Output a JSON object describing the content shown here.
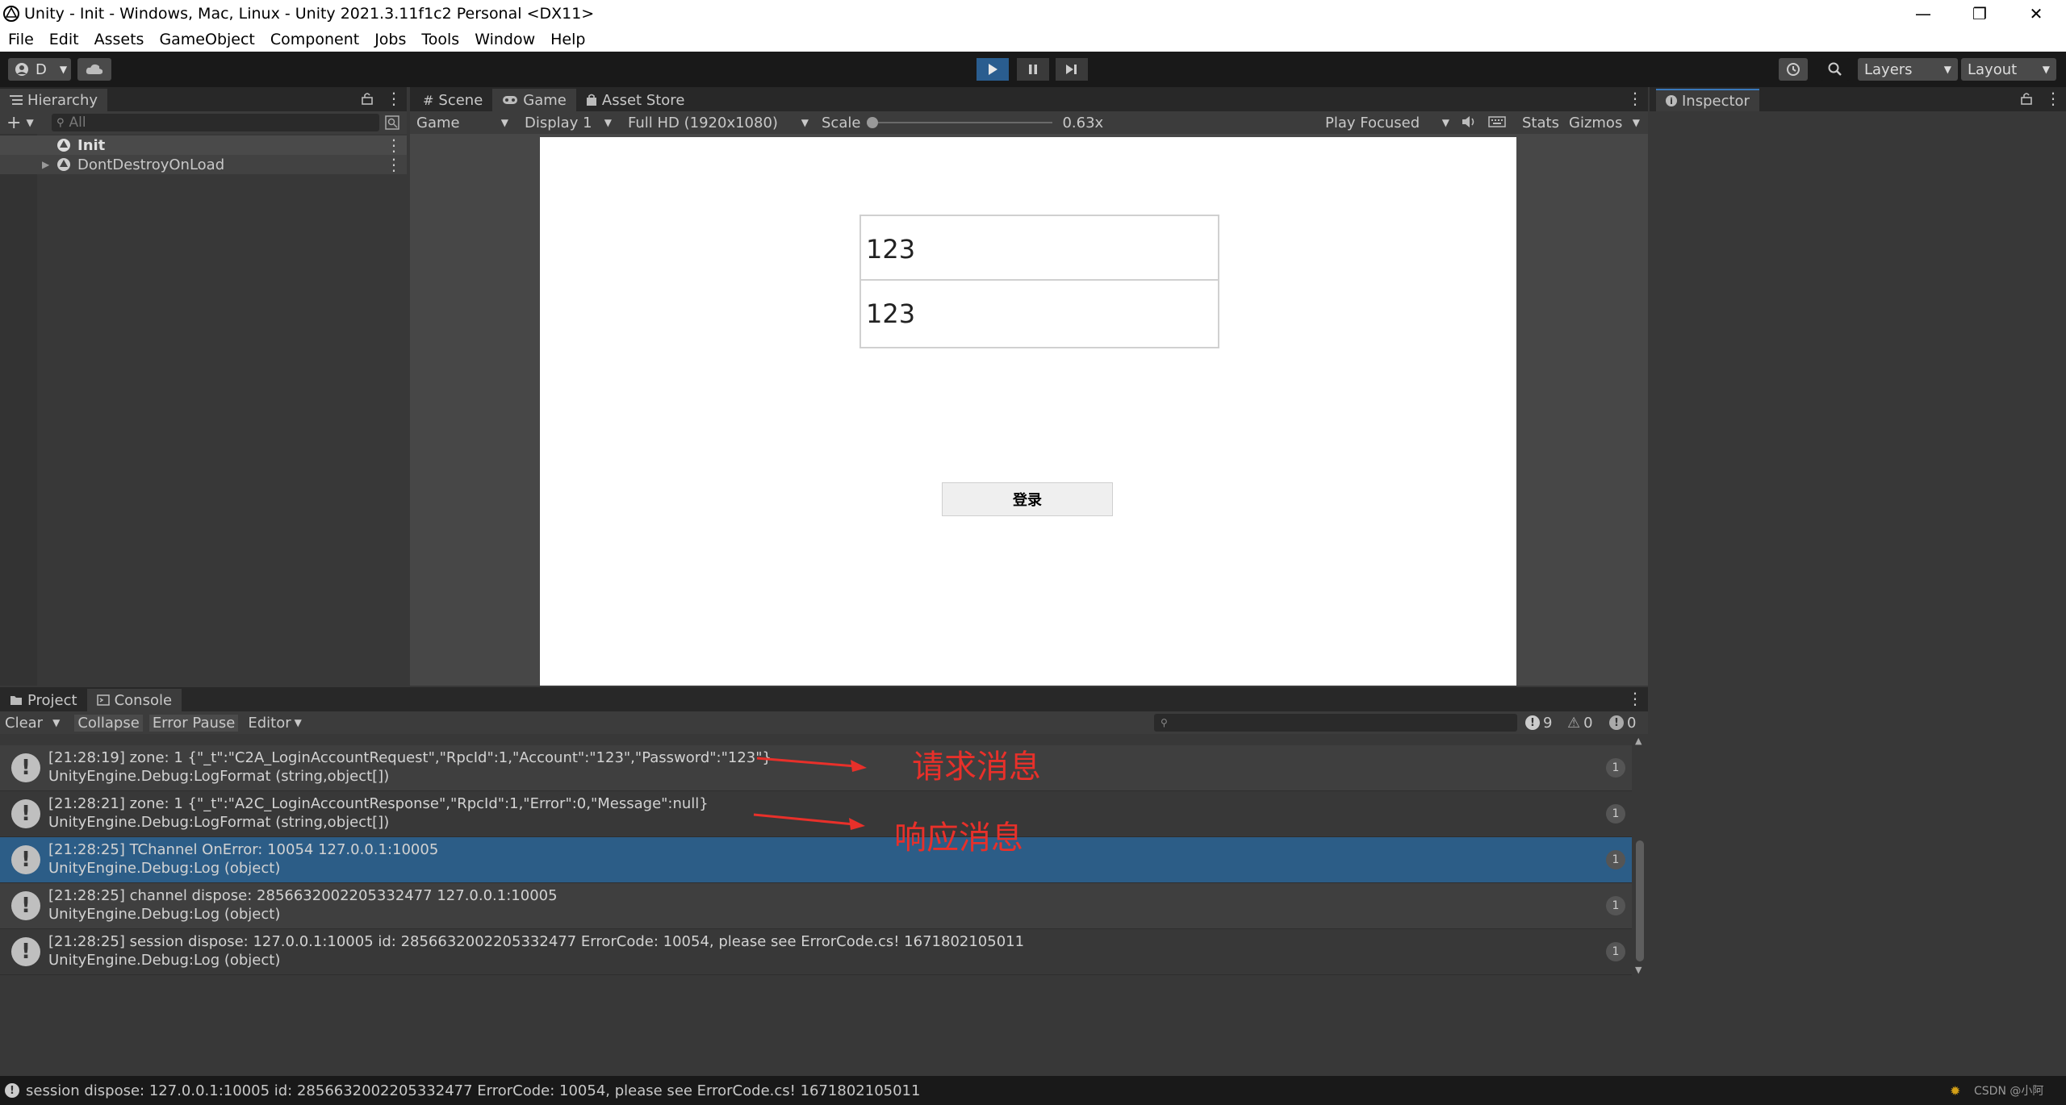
{
  "window": {
    "title": "Unity - Init - Windows, Mac, Linux - Unity 2021.3.11f1c2 Personal <DX11>",
    "minimize": "—",
    "restore": "❐",
    "close": "✕"
  },
  "menu": [
    "File",
    "Edit",
    "Assets",
    "GameObject",
    "Component",
    "Jobs",
    "Tools",
    "Window",
    "Help"
  ],
  "toolbar": {
    "account_label": "D",
    "layers_label": "Layers",
    "layout_label": "Layout"
  },
  "hierarchy": {
    "tab_label": "Hierarchy",
    "search_placeholder": "All",
    "items": [
      "Init",
      "DontDestroyOnLoad"
    ]
  },
  "game": {
    "tabs": [
      "Scene",
      "Game",
      "Asset Store"
    ],
    "mode": "Game",
    "display": "Display 1",
    "resolution": "Full HD (1920x1080)",
    "scale_label": "Scale",
    "scale_value": "0.63x",
    "scale_fraction": 0.0,
    "play_focused": "Play Focused",
    "stats": "Stats",
    "gizmos": "Gizmos",
    "field1_value": "123",
    "field2_value": "123",
    "login_button": "登录"
  },
  "inspector": {
    "tab_label": "Inspector"
  },
  "console": {
    "tabs": [
      "Project",
      "Console"
    ],
    "clear": "Clear",
    "collapse": "Collapse",
    "error_pause": "Error Pause",
    "editor": "Editor",
    "counts": {
      "log": "9",
      "warn": "0",
      "error": "0"
    },
    "entries": [
      {
        "line1": "[21:28:19] zone: 1 {\"_t\":\"C2A_LoginAccountRequest\",\"RpcId\":1,\"Account\":\"123\",\"Password\":\"123\"}",
        "line2": "UnityEngine.Debug:LogFormat (string,object[])",
        "count": "1"
      },
      {
        "line1": "[21:28:21] zone: 1 {\"_t\":\"A2C_LoginAccountResponse\",\"RpcId\":1,\"Error\":0,\"Message\":null}",
        "line2": "UnityEngine.Debug:LogFormat (string,object[])",
        "count": "1"
      },
      {
        "line1": "[21:28:25] TChannel OnError: 10054 127.0.0.1:10005",
        "line2": "UnityEngine.Debug:Log (object)",
        "count": "1"
      },
      {
        "line1": "[21:28:25] channel dispose: 2856632002205332477 127.0.0.1:10005",
        "line2": "UnityEngine.Debug:Log (object)",
        "count": "1"
      },
      {
        "line1": "[21:28:25] session dispose: 127.0.0.1:10005 id: 2856632002205332477 ErrorCode: 10054, please see ErrorCode.cs! 1671802105011",
        "line2": "UnityEngine.Debug:Log (object)",
        "count": "1"
      }
    ],
    "annotations": [
      "请求消息",
      "响应消息"
    ]
  },
  "statusbar": {
    "message": "session dispose: 127.0.0.1:10005 id: 2856632002205332477 ErrorCode: 10054, please see ErrorCode.cs! 1671802105011",
    "watermark": "CSDN @小阿"
  },
  "colors": {
    "accent": "#2c5d87",
    "annotation": "#e8302a",
    "play_active": "#2a5d8f"
  }
}
